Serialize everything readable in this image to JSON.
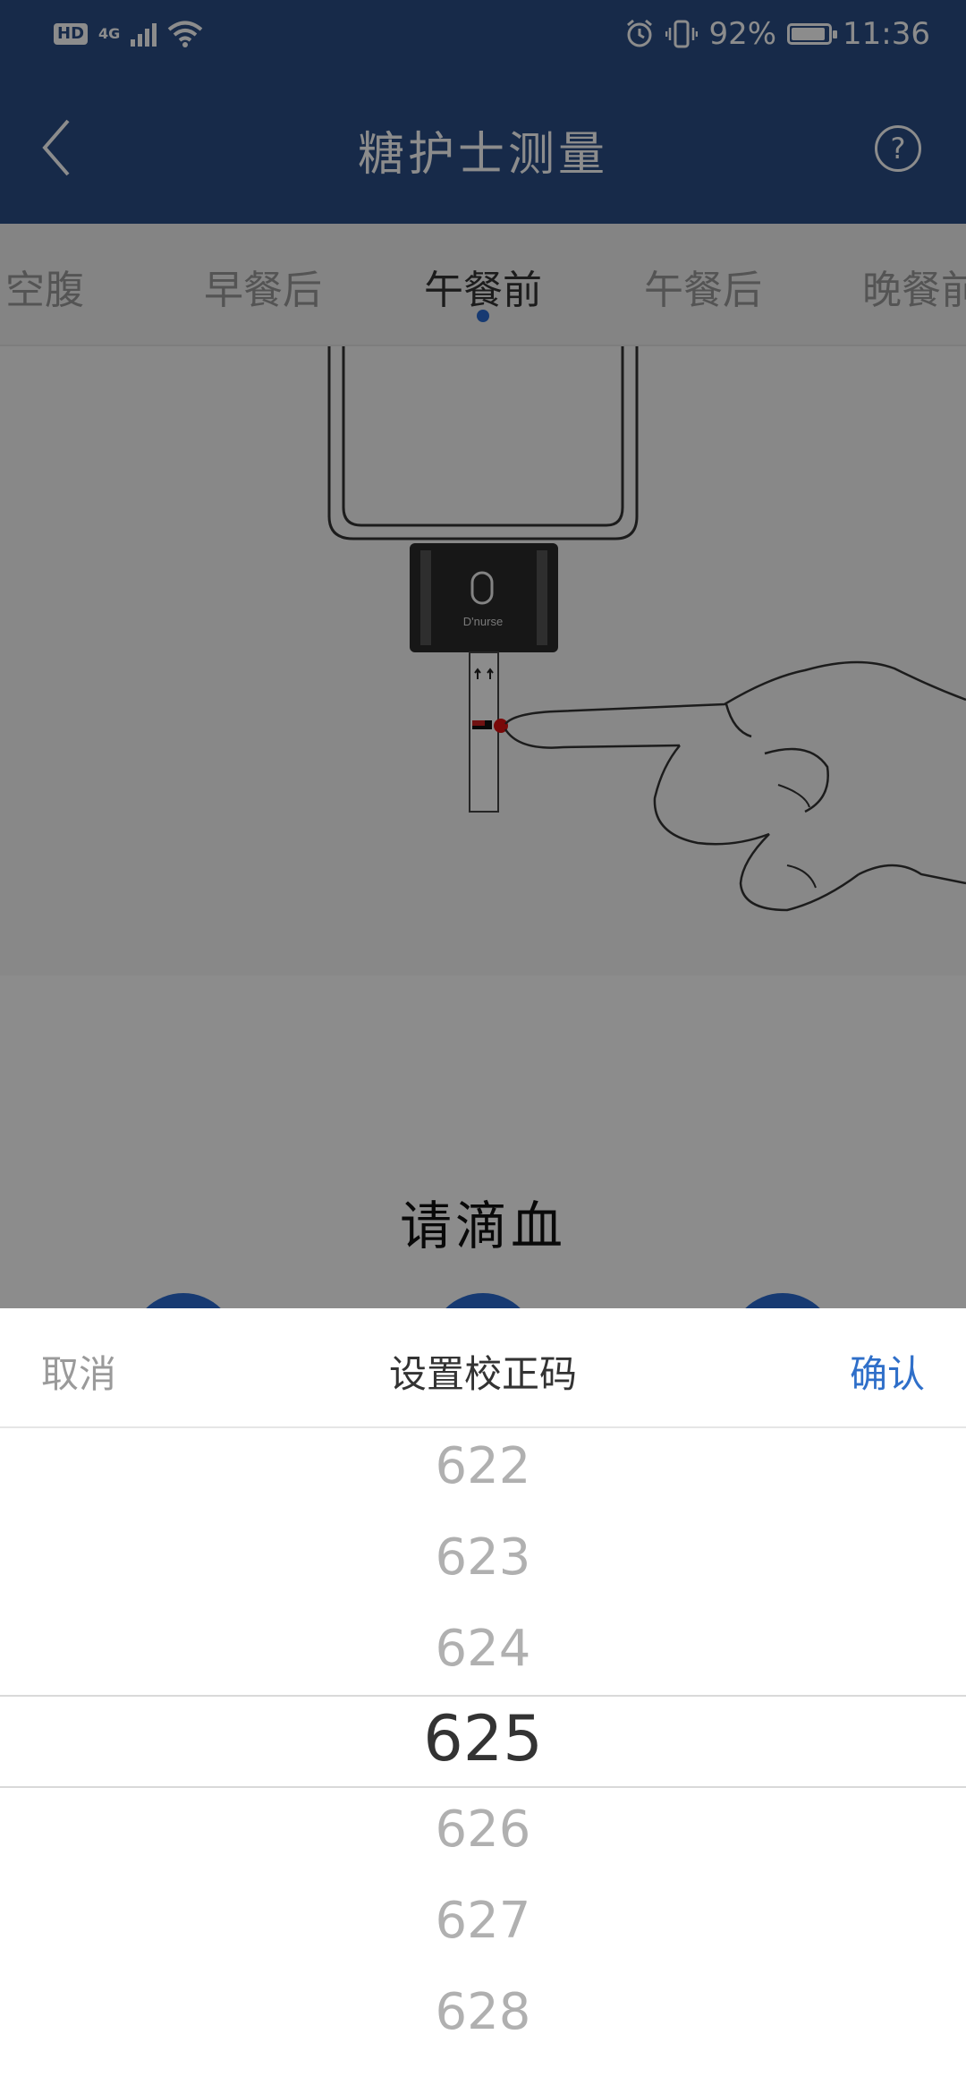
{
  "status_bar": {
    "network_badge": "HD",
    "network_type": "4G",
    "battery_percent": "92%",
    "battery_level": 0.92,
    "time": "11:36",
    "icons": [
      "hd-icon",
      "cellular-signal-icon",
      "wifi-icon",
      "alarm-icon",
      "vibrate-icon",
      "battery-icon"
    ]
  },
  "header": {
    "title": "糖护士测量",
    "back_icon": "chevron-left-icon",
    "help_icon": "question-circle-icon",
    "help_label": "?",
    "background_color": "#2a4e86"
  },
  "tabs": [
    {
      "label": "空腹",
      "active": false
    },
    {
      "label": "早餐后",
      "active": false
    },
    {
      "label": "午餐前",
      "active": true
    },
    {
      "label": "午餐后",
      "active": false
    },
    {
      "label": "晚餐前",
      "active": false
    }
  ],
  "illustration": {
    "device_brand": "D'nurse"
  },
  "instruction": {
    "text": "请滴血"
  },
  "picker_sheet": {
    "cancel_label": "取消",
    "title": "设置校正码",
    "confirm_label": "确认",
    "accent_color": "#2f6fc9",
    "options": [
      "622",
      "623",
      "624",
      "625",
      "626",
      "627",
      "628"
    ],
    "selected_value": "625"
  }
}
